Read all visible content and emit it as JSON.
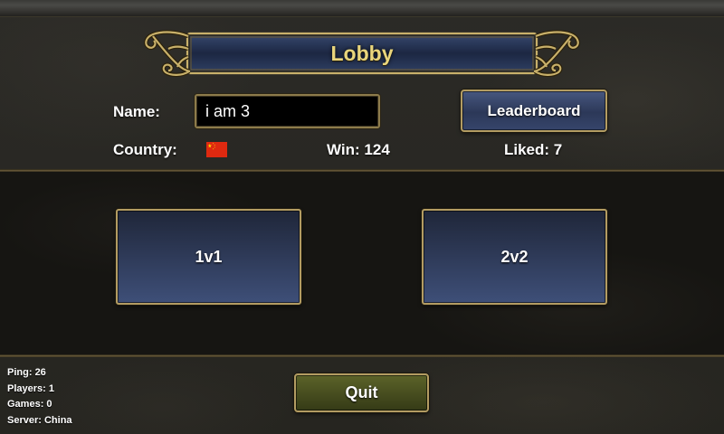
{
  "title": "Lobby",
  "profile": {
    "name_label": "Name:",
    "name_value": "i am 3",
    "country_label": "Country:",
    "country_flag_icon": "china-flag-icon",
    "win_label": "Win:",
    "win_value": 124,
    "liked_label": "Liked:",
    "liked_value": 7
  },
  "buttons": {
    "leaderboard": "Leaderboard",
    "quit": "Quit"
  },
  "modes": [
    {
      "label": "1v1"
    },
    {
      "label": "2v2"
    }
  ],
  "status": [
    {
      "label": "Ping:",
      "value": 26
    },
    {
      "label": "Players:",
      "value": 1
    },
    {
      "label": "Games:",
      "value": 0
    },
    {
      "label": "Server:",
      "value": "China"
    }
  ],
  "theme": {
    "title_gold": "#e9d57c",
    "frame_gold": "#c8b06a",
    "border_gold": "#b39c62",
    "blue_top": "#1f2639",
    "blue_bottom": "#3e4f78",
    "olive_top": "#5c6329",
    "olive_bottom": "#353a16",
    "input_bg": "#000000",
    "flag_red": "#de2910",
    "flag_yellow": "#ffde00"
  }
}
